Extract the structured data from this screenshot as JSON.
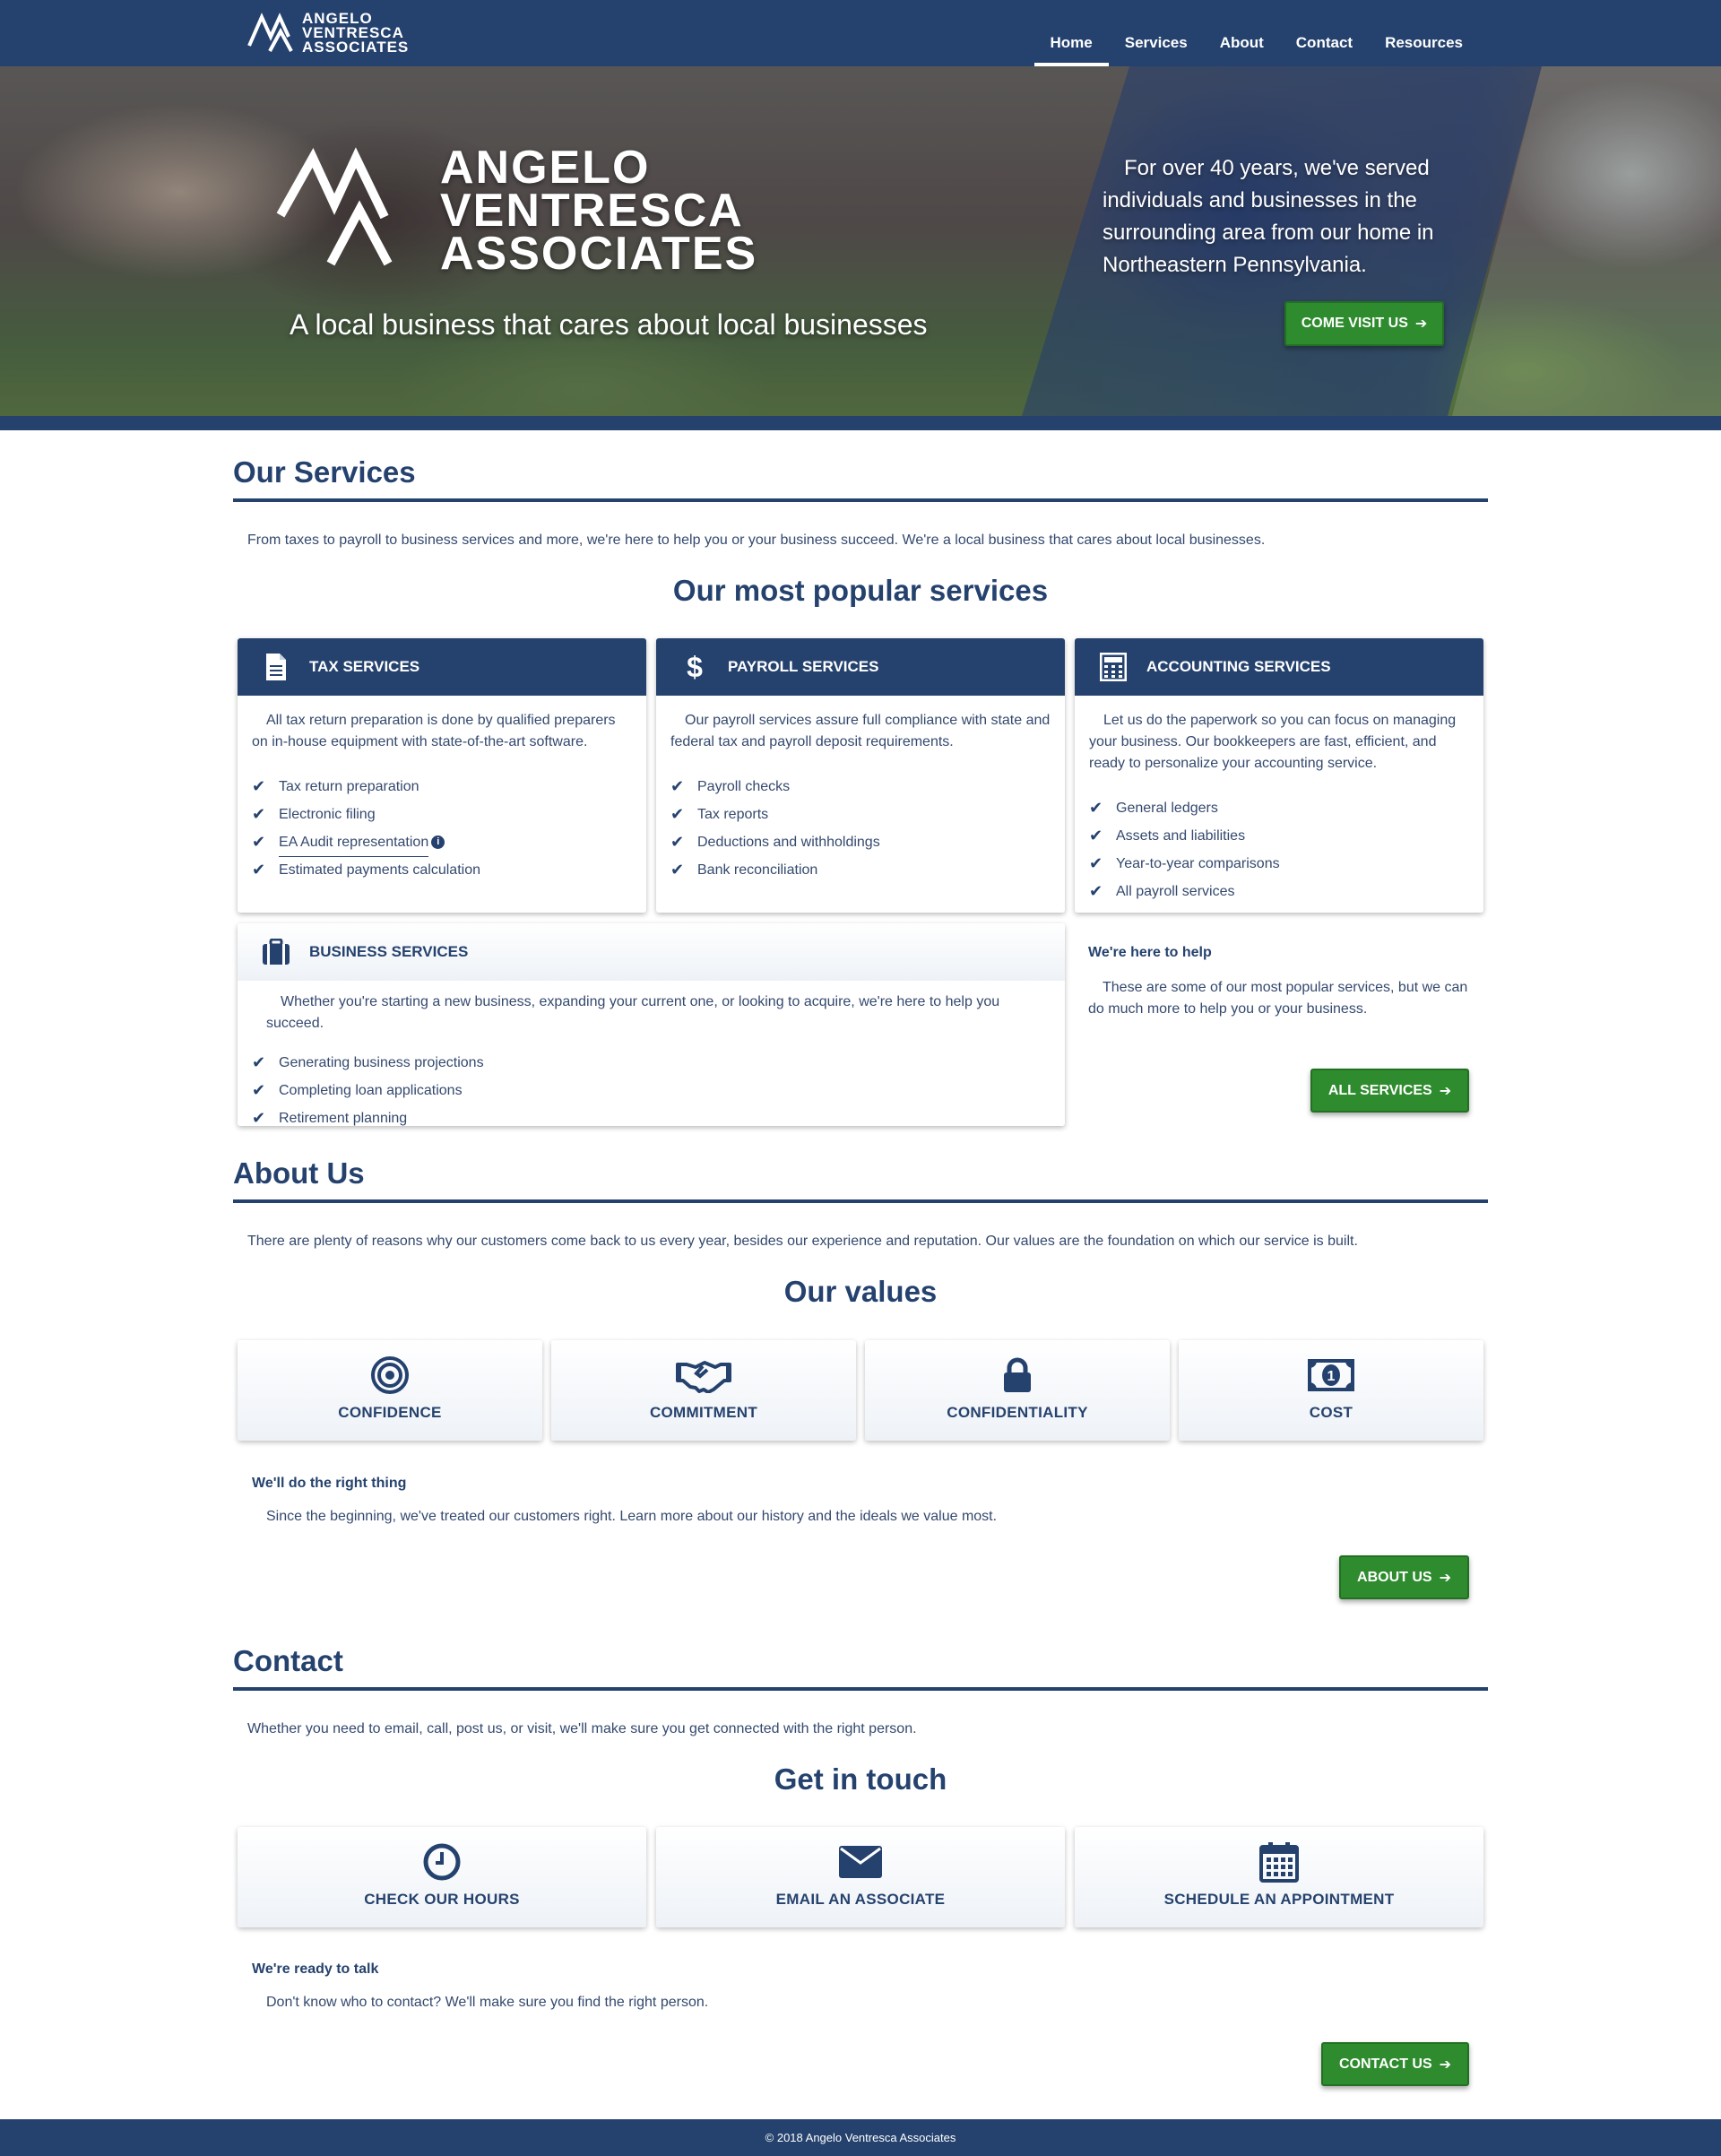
{
  "brand": {
    "line1": "ANGELO",
    "line2": "VENTRESCA",
    "line3": "ASSOCIATES"
  },
  "nav": {
    "items": [
      "Home",
      "Services",
      "About",
      "Contact",
      "Resources"
    ],
    "active": "Home"
  },
  "hero": {
    "tagline": "A local business that cares about local businesses",
    "description": "For over 40 years, we've served individuals and businesses in the surrounding area from our home in Northeastern Pennsylvania.",
    "button": "COME VISIT US"
  },
  "services": {
    "title": "Our Services",
    "lead": "From taxes to payroll to business services and more, we're here to help you or your business succeed. We're a local business that cares about local businesses.",
    "subtitle": "Our most popular services",
    "cards": [
      {
        "title": "TAX SERVICES",
        "icon": "document-icon",
        "desc": "All tax return preparation is done by qualified preparers on in-house equipment with state-of-the-art software.",
        "items": [
          "Tax return preparation",
          "Electronic filing",
          "EA Audit representation",
          "Estimated payments calculation"
        ]
      },
      {
        "title": "PAYROLL SERVICES",
        "icon": "dollar-icon",
        "desc": "Our payroll services assure full compliance with state and federal tax and payroll deposit requirements.",
        "items": [
          "Payroll checks",
          "Tax reports",
          "Deductions and withholdings",
          "Bank reconciliation"
        ]
      },
      {
        "title": "ACCOUNTING SERVICES",
        "icon": "calculator-icon",
        "desc": "Let us do the paperwork so you can focus on managing your business. Our bookkeepers are fast, efficient, and ready to personalize your accounting service.",
        "items": [
          "General ledgers",
          "Assets and liabilities",
          "Year-to-year comparisons",
          "All payroll services"
        ]
      },
      {
        "title": "BUSINESS SERVICES",
        "icon": "briefcase-icon",
        "desc": "Whether you're starting a new business, expanding your current one, or looking to acquire, we're here to help you succeed.",
        "items": [
          "Generating business projections",
          "Completing loan applications",
          "Retirement planning"
        ]
      }
    ],
    "help_title": "We're here to help",
    "help_text": "These are some of our most popular services, but we can do much more to help you or your business.",
    "button": "ALL SERVICES"
  },
  "about": {
    "title": "About Us",
    "lead": "There are plenty of reasons why our customers come back to us every year, besides our experience and reputation. Our values are the foundation on which our service is built.",
    "subtitle": "Our values",
    "values": [
      {
        "label": "CONFIDENCE",
        "icon": "target-icon"
      },
      {
        "label": "COMMITMENT",
        "icon": "handshake-icon"
      },
      {
        "label": "CONFIDENTIALITY",
        "icon": "lock-icon"
      },
      {
        "label": "COST",
        "icon": "money-bill-icon"
      }
    ],
    "note_title": "We'll do the right thing",
    "note_text": "Since the beginning, we've treated our customers right. Learn more about our history and the ideals we value most.",
    "button": "ABOUT US"
  },
  "contact": {
    "title": "Contact",
    "lead": "Whether you need to email, call, post us, or visit, we'll make sure you get connected with the right person.",
    "subtitle": "Get in touch",
    "options": [
      {
        "label": "CHECK OUR HOURS",
        "icon": "clock-icon"
      },
      {
        "label": "EMAIL AN ASSOCIATE",
        "icon": "envelope-icon"
      },
      {
        "label": "SCHEDULE AN APPOINTMENT",
        "icon": "calendar-icon"
      }
    ],
    "note_title": "We're ready to talk",
    "note_text": "Don't know who to contact? We'll make sure you find the right person.",
    "button": "CONTACT US"
  },
  "footer": {
    "text": "© 2018 Angelo Ventresca Associates"
  },
  "colors": {
    "primary": "#25426e",
    "accent_green": "#2e8b2e",
    "text": "#34496e"
  }
}
